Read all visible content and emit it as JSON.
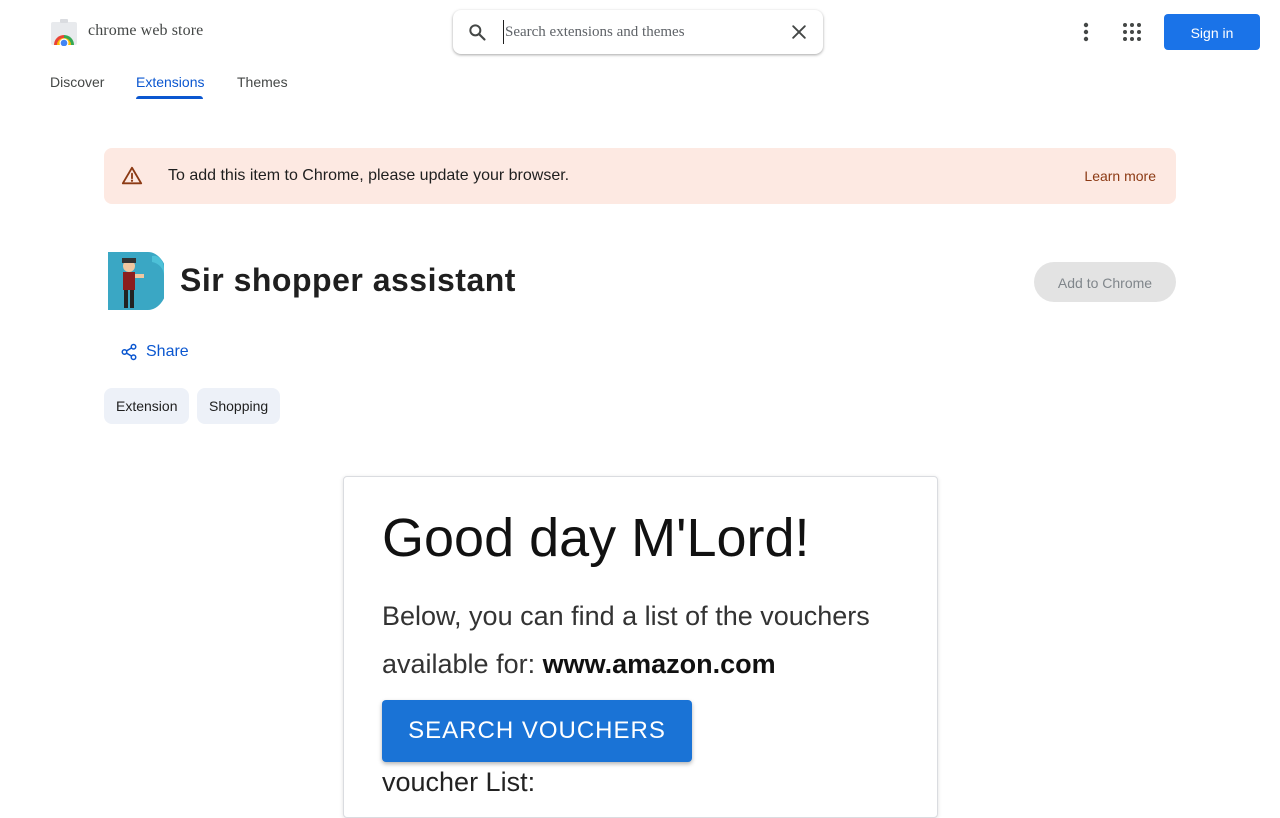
{
  "header": {
    "store_name": "chrome web store",
    "search_placeholder": "Search extensions and themes",
    "signin_label": "Sign in",
    "icons": [
      "chrome-web-store-logo",
      "search-icon",
      "clear-icon",
      "more-vert-icon",
      "apps-grid-icon"
    ]
  },
  "nav": {
    "tabs": [
      {
        "label": "Discover",
        "active": false
      },
      {
        "label": "Extensions",
        "active": true
      },
      {
        "label": "Themes",
        "active": false
      }
    ]
  },
  "banner": {
    "message": "To add this item to Chrome, please update your browser.",
    "link": "Learn more",
    "icon": "warning-icon",
    "background": "#fde9e2"
  },
  "extension": {
    "title": "Sir shopper assistant",
    "add_label": "Add to Chrome",
    "share_label": "Share",
    "chips": [
      "Extension",
      "Shopping"
    ]
  },
  "preview": {
    "heading": "Good day M'Lord!",
    "line1": "Below, you can find a list of the vouchers",
    "line2_prefix": "available for: ",
    "line2_site": "www.amazon.com",
    "button": "SEARCH VOUCHERS",
    "list_label": "voucher List:"
  },
  "colors": {
    "accent": "#0b57d0",
    "primary_button": "#1a73e8",
    "disabled_button": "#e3e3e3"
  }
}
